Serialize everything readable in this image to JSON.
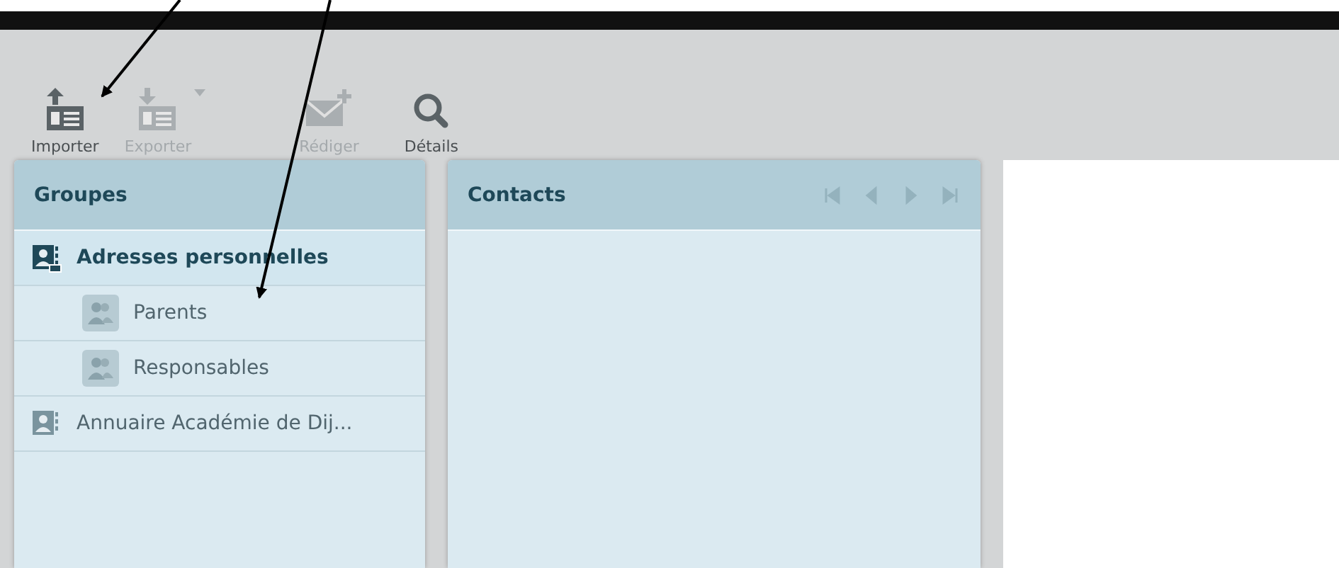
{
  "toolbar": {
    "buttons": [
      {
        "kind": "import",
        "label": "Importer",
        "disabled": false,
        "dropdown": false
      },
      {
        "kind": "export",
        "label": "Exporter",
        "disabled": true,
        "dropdown": true
      },
      {
        "kind": "compose",
        "label": "Rédiger",
        "disabled": true,
        "dropdown": false
      },
      {
        "kind": "details",
        "label": "Détails",
        "disabled": false,
        "dropdown": false
      }
    ]
  },
  "groups": {
    "title": "Groupes",
    "items": [
      {
        "label": "Adresses personnelles",
        "selected": true,
        "expanded": true,
        "children": [
          {
            "label": "Parents",
            "selected": false
          },
          {
            "label": "Responsables",
            "selected": false
          }
        ]
      },
      {
        "label": "Annuaire Académie de Dij...",
        "selected": false
      }
    ]
  },
  "contacts": {
    "title": "Contacts",
    "pager": [
      {
        "kind": "first",
        "disabled": true
      },
      {
        "kind": "prev",
        "disabled": true
      },
      {
        "kind": "next",
        "disabled": true
      },
      {
        "kind": "last",
        "disabled": true
      }
    ]
  }
}
